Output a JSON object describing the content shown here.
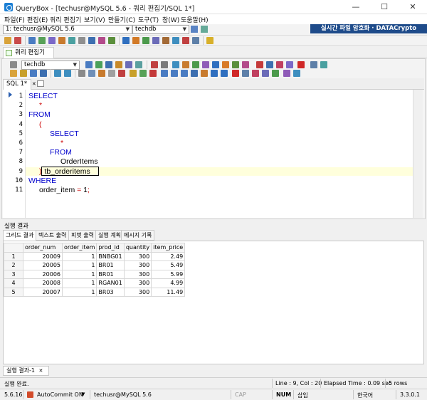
{
  "window": {
    "title": "QueryBox - [techusr@MySQL 5.6 - 쿼리 편집기/SQL 1*]",
    "minimize": "—",
    "maximize": "☐",
    "close": "✕"
  },
  "menu": [
    {
      "label": "파일(F)"
    },
    {
      "label": "편집(E)"
    },
    {
      "label": "쿼리 편집기"
    },
    {
      "label": "보기(V)"
    },
    {
      "label": "만들기(C)"
    },
    {
      "label": "도구(T)"
    },
    {
      "label": "창(W)"
    },
    {
      "label": "도움말(H)"
    }
  ],
  "connection": {
    "server": "1: techusr@MySQL 5.6",
    "database": "techdb"
  },
  "banner": "실시간 파일 암호화 · DATACrypto",
  "doc_tab": "쿼리 편집기",
  "editor_db": "techdb",
  "sql_tab": "SQL 1*",
  "sql_tab_close": "✕",
  "code_lines": [
    {
      "n": "1",
      "parts": [
        {
          "t": "SELECT",
          "c": "kw"
        }
      ]
    },
    {
      "n": "2",
      "parts": [
        {
          "t": "*",
          "c": "op"
        }
      ]
    },
    {
      "n": "3",
      "parts": [
        {
          "t": "FROM",
          "c": "kw"
        }
      ]
    },
    {
      "n": "4",
      "parts": [
        {
          "t": "(",
          "c": "op"
        }
      ]
    },
    {
      "n": "5",
      "parts": [
        {
          "t": "SELECT",
          "c": "kw"
        }
      ]
    },
    {
      "n": "6",
      "parts": [
        {
          "t": "*",
          "c": "op"
        }
      ]
    },
    {
      "n": "7",
      "parts": [
        {
          "t": "FROM",
          "c": "kw"
        }
      ]
    },
    {
      "n": "8",
      "parts": [
        {
          "t": "OrderItems",
          "c": "id"
        }
      ]
    },
    {
      "n": "9",
      "parts": [
        {
          "t": ")",
          "c": "op"
        },
        {
          "t": "tb_orderitems",
          "c": "id"
        }
      ]
    },
    {
      "n": "10",
      "parts": [
        {
          "t": "WHERE",
          "c": "kw"
        }
      ]
    },
    {
      "n": "11",
      "parts": [
        {
          "t": "order_item",
          "c": "id"
        },
        {
          "t": " = ",
          "c": "op"
        },
        {
          "t": "1",
          "c": "id"
        },
        {
          "t": ";",
          "c": "op"
        }
      ]
    }
  ],
  "results": {
    "label": "실행 결과",
    "tabs": [
      "그리드 결과",
      "텍스트 출력",
      "피벗 출력",
      "실행 계획",
      "메시지 기록"
    ],
    "columns": [
      "order_num",
      "order_item",
      "prod_id",
      "quantity",
      "item_price"
    ],
    "rows": [
      [
        "1",
        "20009",
        "1",
        "BNBG01",
        "300",
        "2.49"
      ],
      [
        "2",
        "20005",
        "1",
        "BR01",
        "300",
        "5.49"
      ],
      [
        "3",
        "20006",
        "1",
        "BR01",
        "300",
        "5.99"
      ],
      [
        "4",
        "20008",
        "1",
        "RGAN01",
        "300",
        "4.99"
      ],
      [
        "5",
        "20007",
        "1",
        "BR03",
        "300",
        "11.49"
      ]
    ],
    "bottom_tab": "실행 결과-1"
  },
  "status1": {
    "message": "실행 완료.",
    "position": "Line : 9, Col : 20",
    "elapsed": "Elapsed Time : 0.09 sec",
    "rows": "5 rows"
  },
  "status2": {
    "version": "5.6.16",
    "autocommit": "AutoCommit ON",
    "conn": "techusr@MySQL 5.6",
    "cap": "CAP",
    "num": "NUM",
    "ins": "삽입",
    "lang": "한국어",
    "app_version": "3.3.0.1"
  }
}
